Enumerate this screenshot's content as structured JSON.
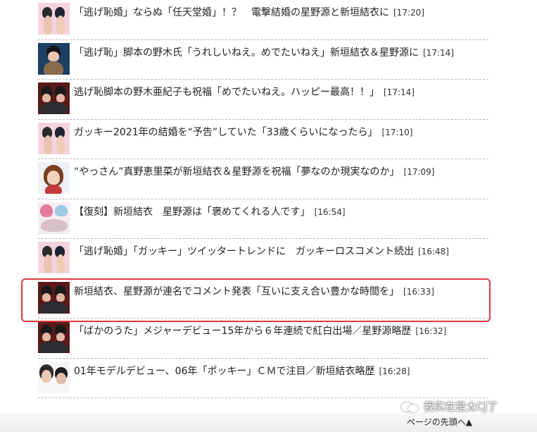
{
  "news": [
    {
      "title": "「逃げ恥婚」ならぬ「任天堂婚」！？　電撃結婚の星野源と新垣結衣に",
      "time": "[17:20]",
      "thumb": "pink"
    },
    {
      "title": "「逃げ恥」脚本の野木氏「うれしいねえ。めでたいねえ」新垣結衣＆星野源に",
      "time": "[17:14]",
      "thumb": "blue"
    },
    {
      "title": "逃げ恥脚本の野木亜紀子も祝福「めでたいねえ。ハッピー最高！！」",
      "time": "[17:14]",
      "thumb": "dark"
    },
    {
      "title": "ガッキー2021年の結婚を“予告”していた「33歳くらいになったら」",
      "time": "[17:10]",
      "thumb": "pink"
    },
    {
      "title": "“やっさん”真野恵里菜が新垣結衣＆星野源を祝福「夢なのか現実なのか」",
      "time": "[17:09]",
      "thumb": "light"
    },
    {
      "title": "【復刻】新垣結衣　星野源は「褒めてくれる人です」",
      "time": "[16:54]",
      "thumb": "paper"
    },
    {
      "title": "「逃げ恥婚」「ガッキー」ツイッタートレンドに　ガッキーロスコメント続出",
      "time": "[16:48]",
      "thumb": "pink"
    },
    {
      "title": "新垣結衣、星野源が連名でコメント発表「互いに支え合い豊かな時間を」",
      "time": "[16:33]",
      "thumb": "dark"
    },
    {
      "title": "「ばかのうた」メジャーデビュー15年から６年連続で紅白出場／星野源略歴",
      "time": "[16:32]",
      "thumb": "dark"
    },
    {
      "title": "01年モデルデビュー、06年「ポッキー」ＣＭで注目／新垣結衣略歴",
      "time": "[16:28]",
      "thumb": "white"
    }
  ],
  "footer": {
    "page_top": "ページの先頭へ▲",
    "watermark": "我实在是太CJ了"
  },
  "colors": {
    "highlight": "#e0393e",
    "divider": "#b8b8b8"
  }
}
